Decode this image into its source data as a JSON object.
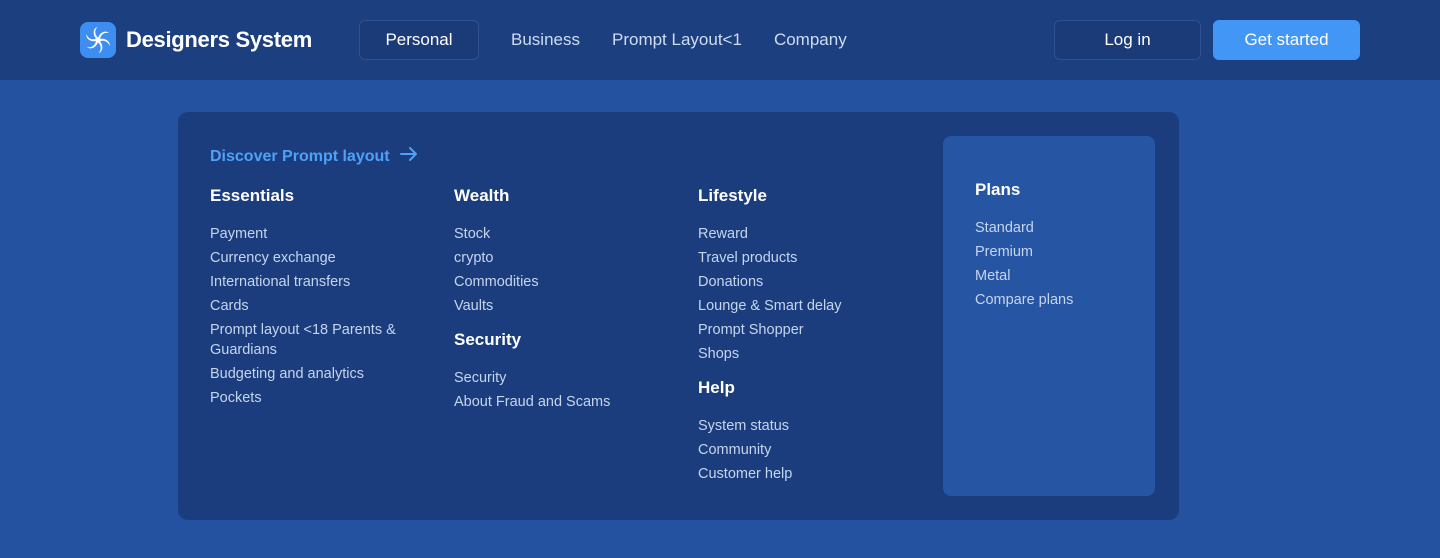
{
  "brand": {
    "name": "Designers System",
    "logo_icon": "swirl-logo-icon"
  },
  "nav": [
    {
      "label": "Personal",
      "active": true
    },
    {
      "label": "Business"
    },
    {
      "label": "Prompt Layout<1"
    },
    {
      "label": "Company"
    }
  ],
  "actions": {
    "login_label": "Log in",
    "get_started_label": "Get started"
  },
  "menu": {
    "discover_label": "Discover Prompt layout",
    "essentials": {
      "title": "Essentials",
      "items": [
        "Payment",
        "Currency exchange",
        "International transfers",
        "Cards",
        "Prompt layout <18 Parents & Guardians",
        "Budgeting and analytics",
        "Pockets"
      ]
    },
    "wealth": {
      "title": "Wealth",
      "items": [
        "Stock",
        "crypto",
        "Commodities",
        "Vaults"
      ]
    },
    "security": {
      "title": "Security",
      "items": [
        "Security",
        "About Fraud and Scams"
      ]
    },
    "lifestyle": {
      "title": "Lifestyle",
      "items": [
        "Reward",
        "Travel products",
        "Donations",
        "Lounge & Smart delay",
        "Prompt Shopper",
        "Shops"
      ]
    },
    "help": {
      "title": "Help",
      "items": [
        "System status",
        "Community",
        "Customer help"
      ]
    },
    "plans": {
      "title": "Plans",
      "items": [
        "Standard",
        "Premium",
        "Metal",
        "Compare plans"
      ]
    }
  },
  "colors": {
    "page_bg": "#2452a0",
    "header_bg": "#1c3f80",
    "panel_bg": "#1b3d7d",
    "plans_bg": "#2655a4",
    "accent": "#4296f5",
    "link_accent": "#4fa0f7"
  }
}
